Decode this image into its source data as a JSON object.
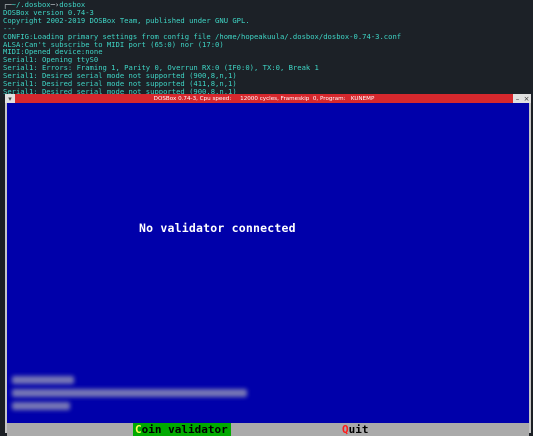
{
  "terminal": {
    "prompt_user": "~",
    "prompt_path": "/.dosbox",
    "prompt_command": "dosbox",
    "lines": [
      "DOSBox version 0.74-3",
      "Copyright 2002-2019 DOSBox Team, published under GNU GPL.",
      "---",
      "CONFIG:Loading primary settings from config file /home/hopeakuula/.dosbox/dosbox-0.74-3.conf",
      "ALSA:Can't subscribe to MIDI port (65:0) nor (17:0)",
      "MIDI:Opened device:none",
      "Serial1: Opening ttyS0",
      "Serial1: Errors: Framing 1, Parity 0, Overrun RX:0 (IF0:0), TX:0, Break 1",
      "Serial1: Desired serial mode not supported (900,8,n,1)",
      "Serial1: Desired serial mode not supported (411,8,n,1)",
      "Serial1: Desired serial mode not supported (900,8,n,1)"
    ]
  },
  "window": {
    "title": "DOSBox 0.74-3, Cpu speed:     12000 cycles, Frameskip  0, Program:   KUNEMP",
    "menu_icon": "window-menu-icon",
    "minimize": "–",
    "close": "×"
  },
  "screen": {
    "message": "No validator connected",
    "menu": {
      "coin_hotkey": "C",
      "coin_rest": "oin validator",
      "quit_hotkey": "Q",
      "quit_rest": "uit"
    }
  },
  "colors": {
    "dos_blue": "#0000aa",
    "title_red": "#d6282d",
    "menu_gray": "#aaaaaa",
    "highlight_green": "#00aa00",
    "terminal_text": "#3fd6c6"
  }
}
